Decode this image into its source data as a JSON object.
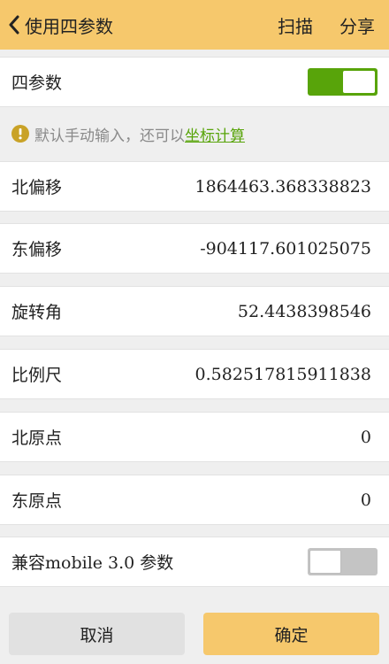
{
  "header": {
    "title": "使用四参数",
    "scan_label": "扫描",
    "share_label": "分享"
  },
  "four_params": {
    "label": "四参数",
    "enabled": true
  },
  "hint": {
    "text": "默认手动输入，还可以",
    "link": "坐标计算"
  },
  "fields": {
    "north_offset": {
      "label": "北偏移",
      "value": "1864463.368338823"
    },
    "east_offset": {
      "label": "东偏移",
      "value": "-904117.601025075"
    },
    "rotation": {
      "label": "旋转角",
      "value": "52.4438398546"
    },
    "scale": {
      "label": "比例尺",
      "value": "0.582517815911838"
    },
    "north_origin": {
      "label": "北原点",
      "value": "0"
    },
    "east_origin": {
      "label": "东原点",
      "value": "0"
    }
  },
  "compat": {
    "label": "兼容mobile 3.0 参数",
    "enabled": false
  },
  "footer": {
    "cancel_label": "取消",
    "confirm_label": "确定"
  },
  "colors": {
    "header_bg": "#f6c86c",
    "accent_green": "#58a40a",
    "info_icon": "#c9a227"
  }
}
